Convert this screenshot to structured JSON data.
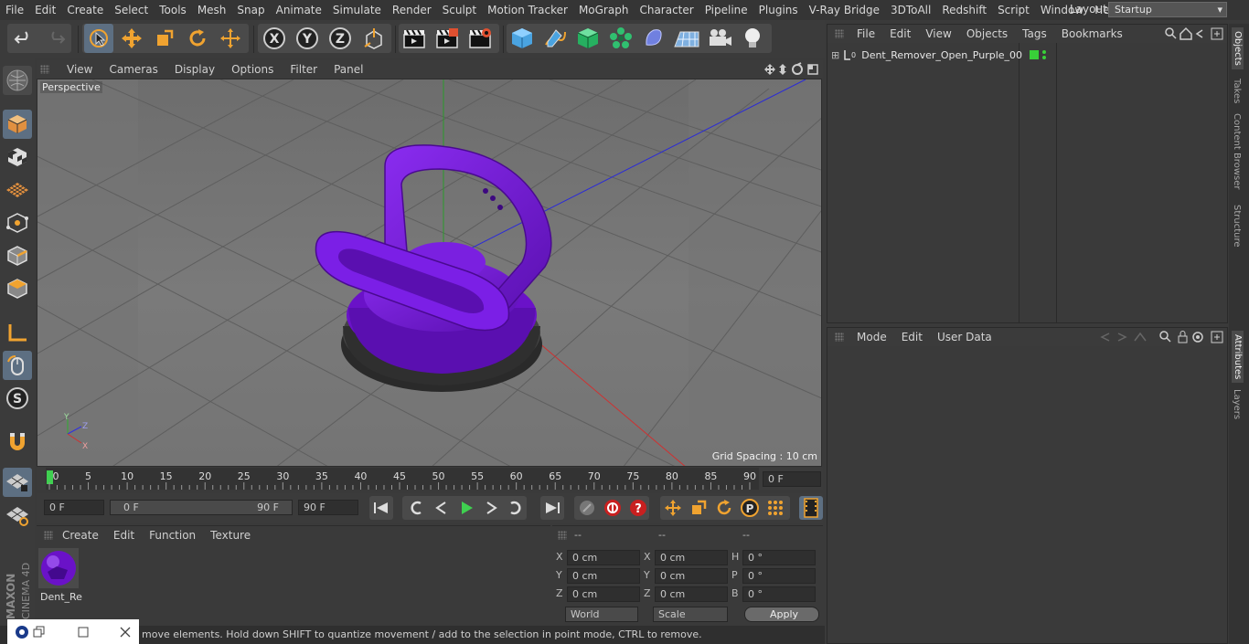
{
  "menubar": {
    "items": [
      "File",
      "Edit",
      "Create",
      "Select",
      "Tools",
      "Mesh",
      "Snap",
      "Animate",
      "Simulate",
      "Render",
      "Sculpt",
      "Motion Tracker",
      "MoGraph",
      "Character",
      "Pipeline",
      "Plugins",
      "V-Ray Bridge",
      "3DToAll",
      "Redshift",
      "Script",
      "Window",
      "Help"
    ],
    "layout_label": "Layout:",
    "layout_value": "Startup"
  },
  "viewport": {
    "menu": [
      "View",
      "Cameras",
      "Display",
      "Options",
      "Filter",
      "Panel"
    ],
    "label": "Perspective",
    "grid_spacing": "Grid Spacing : 10 cm",
    "axis_labels": {
      "y": "Y",
      "z": "Z",
      "x": "X"
    }
  },
  "timeline": {
    "ticks": [
      "0",
      "5",
      "10",
      "15",
      "20",
      "25",
      "30",
      "35",
      "40",
      "45",
      "50",
      "55",
      "60",
      "65",
      "70",
      "75",
      "80",
      "85",
      "90"
    ],
    "current_frame": "0 F"
  },
  "controls": {
    "start_frame": "0 F",
    "range_start": "0 F",
    "range_end": "90 F",
    "end_frame": "90 F"
  },
  "material_manager": {
    "menu": [
      "Create",
      "Edit",
      "Function",
      "Texture"
    ],
    "material_name": "Dent_Re"
  },
  "coordinates": {
    "headers": [
      "--",
      "--",
      "--"
    ],
    "rows": [
      {
        "a_label": "X",
        "a_val": "0 cm",
        "b_label": "X",
        "b_val": "0 cm",
        "c_label": "H",
        "c_val": "0 °"
      },
      {
        "a_label": "Y",
        "a_val": "0 cm",
        "b_label": "Y",
        "b_val": "0 cm",
        "c_label": "P",
        "c_val": "0 °"
      },
      {
        "a_label": "Z",
        "a_val": "0 cm",
        "b_label": "Z",
        "b_val": "0 cm",
        "c_label": "B",
        "c_val": "0 °"
      }
    ],
    "mode_select": "World",
    "scale_select": "Scale",
    "apply_label": "Apply"
  },
  "object_manager": {
    "menu": [
      "File",
      "Edit",
      "View",
      "Objects",
      "Tags",
      "Bookmarks"
    ],
    "object_name": "Dent_Remover_Open_Purple_001"
  },
  "attribute_manager": {
    "menu": [
      "Mode",
      "Edit",
      "User Data"
    ]
  },
  "right_tabs": [
    "Objects",
    "Takes",
    "Content Browser",
    "Structure",
    "Attributes",
    "Layers"
  ],
  "status": {
    "text": "move elements. Hold down SHIFT to quantize movement / add to the selection in point mode, CTRL to remove."
  },
  "brand": {
    "line1": "MAXON",
    "line2": "CINEMA 4D"
  },
  "colors": {
    "accent": "#f0a330",
    "object_purple": "#7a17d6",
    "active_blue": "#5d6f82"
  }
}
